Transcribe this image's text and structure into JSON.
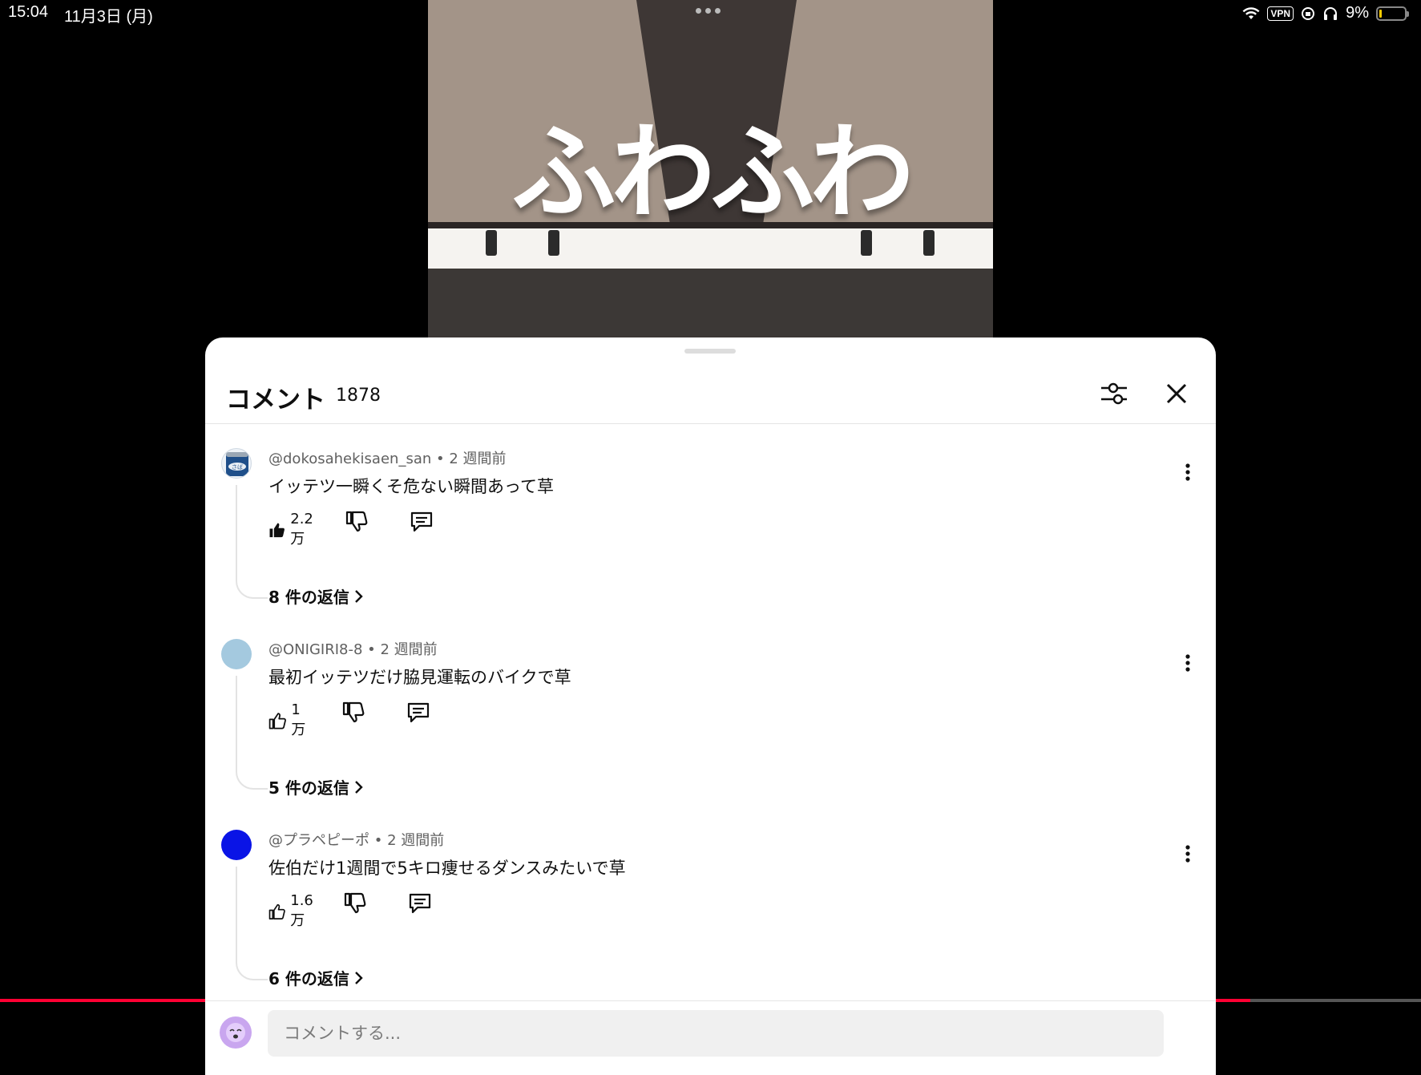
{
  "status_bar": {
    "time": "15:04",
    "date": "11月3日 (月)",
    "vpn": "VPN",
    "battery": "9%"
  },
  "video": {
    "sign_text": "ふわふわ",
    "progress_fraction": 0.88,
    "accent_color": "#ff0033"
  },
  "comments_panel": {
    "title": "コメント",
    "count": "1878",
    "comments": [
      {
        "author": "@dokosahekisaen_san",
        "age": "2 週間前",
        "text": "イッテツ一瞬くそ危ない瞬間あって草",
        "likes": "2.2万",
        "liked": true,
        "replies": "8 件の返信",
        "avatar_color": "#1f4f8a",
        "avatar_label": "さば"
      },
      {
        "author": "@ONIGIRI8-8",
        "age": "2 週間前",
        "text": "最初イッテツだけ脇見運転のバイクで草",
        "likes": "1万",
        "liked": false,
        "replies": "5 件の返信",
        "avatar_color": "#a4c9df"
      },
      {
        "author": "@プラペピーポ",
        "age": "2 週間前",
        "text": "佐伯だけ1週間で5キロ痩せるダンスみたいで草",
        "likes": "1.6万",
        "liked": false,
        "replies": "6 件の返信",
        "avatar_color": "#0a14e6"
      }
    ],
    "composer": {
      "placeholder": "コメントする..."
    }
  }
}
